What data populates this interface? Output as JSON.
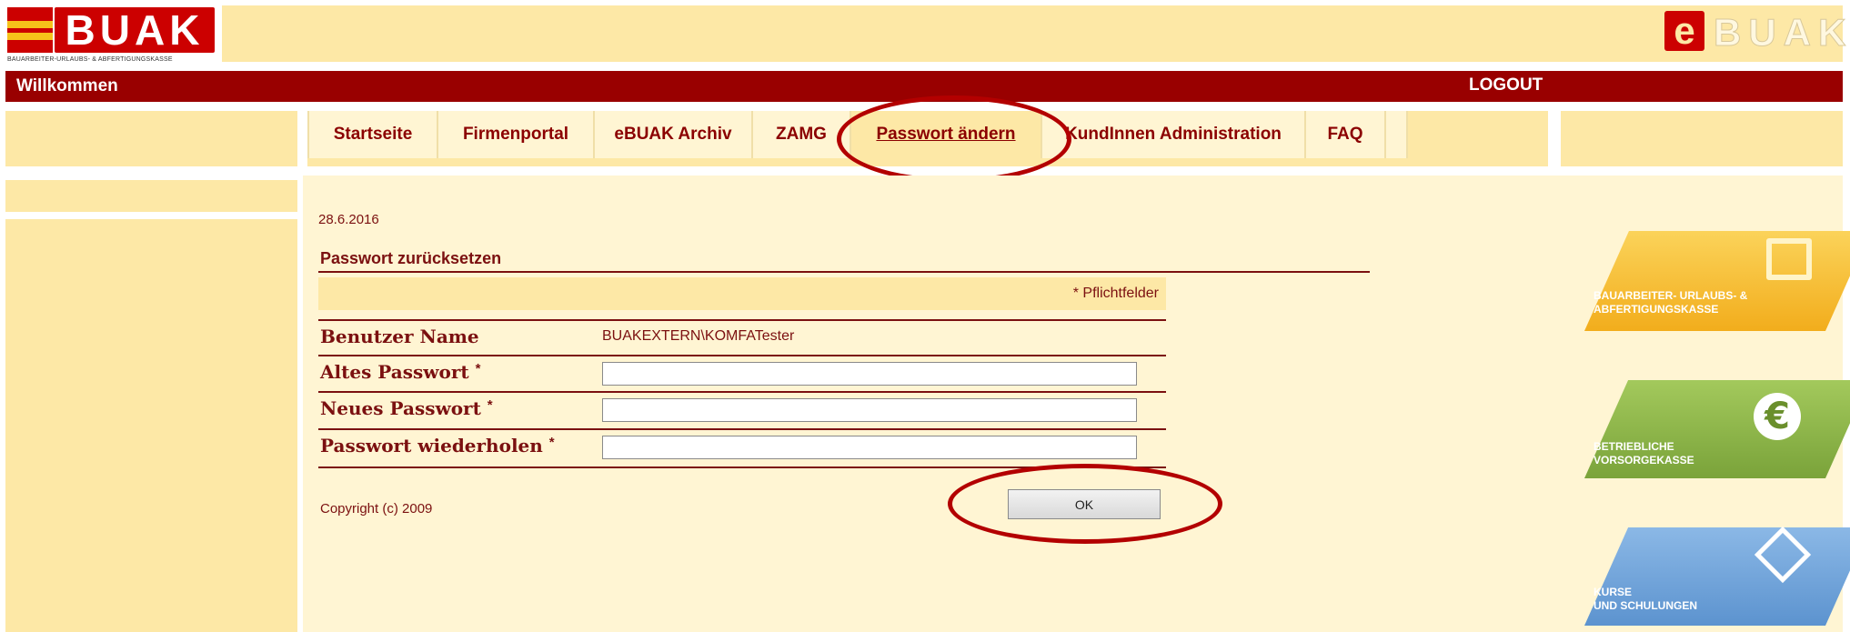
{
  "header": {
    "logo_text": "BUAK",
    "logo_subtitle": "BAUARBEITER-URLAUBS- & ABFERTIGUNGSKASSE",
    "ebuak_e": "e",
    "ebuak_text": "BUAK",
    "welcome": "Willkommen",
    "logout": "LOGOUT"
  },
  "nav": {
    "tabs": [
      {
        "label": "Startseite",
        "active": false
      },
      {
        "label": "Firmenportal",
        "active": false
      },
      {
        "label": "eBUAK Archiv",
        "active": false
      },
      {
        "label": "ZAMG",
        "active": false
      },
      {
        "label": "Passwort ändern",
        "active": true
      },
      {
        "label": "KundInnen Administration",
        "active": false
      },
      {
        "label": "FAQ",
        "active": false
      }
    ]
  },
  "main": {
    "date": "28.6.2016",
    "form_title": "Passwort zurücksetzen",
    "required_note": "* Pflichtfelder",
    "fields": [
      {
        "label": "Benutzer Name",
        "required": false,
        "value": "BUAKEXTERN\\KOMFATester"
      },
      {
        "label": "Altes Passwort",
        "required": true,
        "value": ""
      },
      {
        "label": "Neues Passwort",
        "required": true,
        "value": ""
      },
      {
        "label": "Passwort wiederholen",
        "required": true,
        "value": ""
      }
    ],
    "required_star": "*",
    "ok_label": "OK",
    "copyright": "Copyright (c) 2009"
  },
  "side_tiles": [
    {
      "line1": "BAUARBEITER- URLAUBS- &",
      "line2": "ABFERTIGUNGSKASSE",
      "color": "#f5b731",
      "icon": "frame-icon"
    },
    {
      "line1": "BETRIEBLICHE",
      "line2": "VORSORGEKASSE",
      "color": "#8fb84a",
      "icon": "euro-icon"
    },
    {
      "line1": "KURSE",
      "line2": "UND SCHULUNGEN",
      "color": "#6fa3d8",
      "icon": "book-icon"
    }
  ],
  "colors": {
    "accent": "#990000",
    "panel": "#fde8a6",
    "panel_light": "#fff5d3",
    "highlight": "#b30000"
  }
}
